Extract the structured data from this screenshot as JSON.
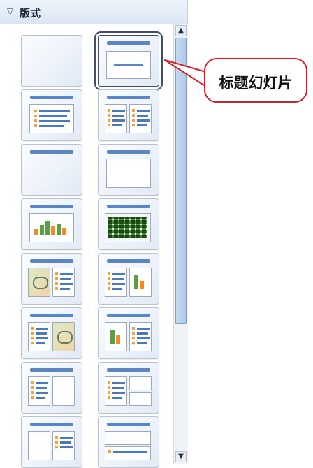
{
  "panel": {
    "title": "版式",
    "collapse_icon": "triangle-down-icon"
  },
  "layouts": [
    {
      "name": "blank-style-1"
    },
    {
      "name": "title-slide"
    },
    {
      "name": "title-content"
    },
    {
      "name": "title-two-content"
    },
    {
      "name": "title-only"
    },
    {
      "name": "title-content-box"
    },
    {
      "name": "title-chart"
    },
    {
      "name": "title-table"
    },
    {
      "name": "title-clipart-text"
    },
    {
      "name": "title-text-chart"
    },
    {
      "name": "title-text-clipart"
    },
    {
      "name": "title-chart-text"
    },
    {
      "name": "title-text-box"
    },
    {
      "name": "title-text-two-boxes"
    },
    {
      "name": "title-box-text"
    },
    {
      "name": "title-box-text-2"
    }
  ],
  "callout": {
    "label": "标题幻灯片",
    "border_color": "#d31f2a"
  },
  "scrollbar": {
    "up_icon": "scroll-up-arrow-icon",
    "down_icon": "scroll-down-arrow-icon"
  }
}
